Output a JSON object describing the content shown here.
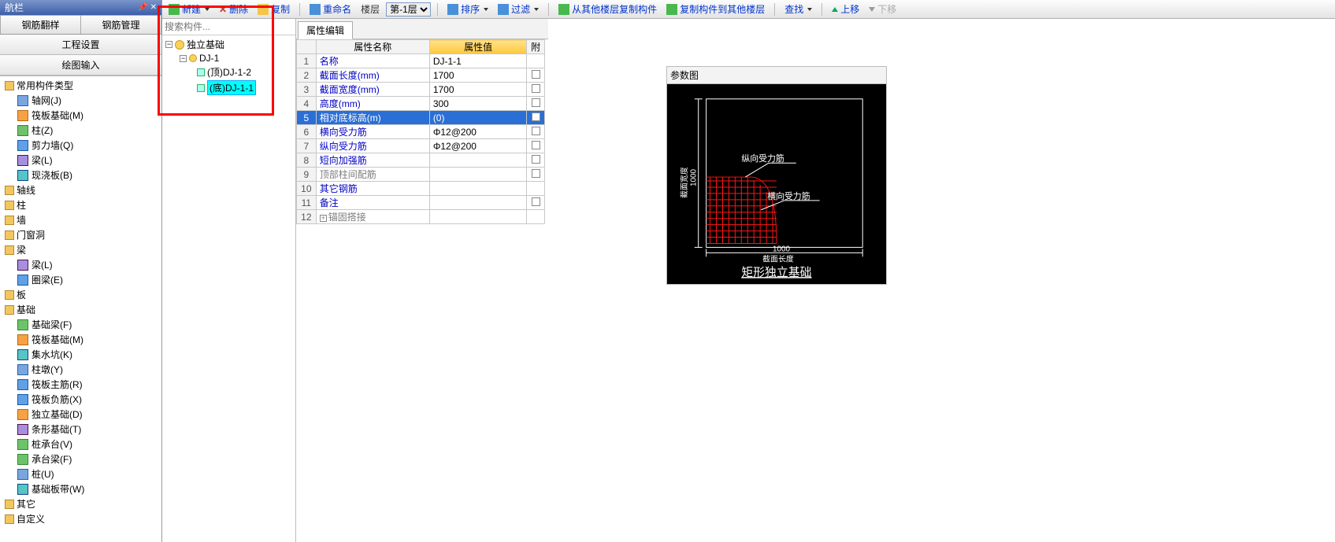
{
  "nav": {
    "title": "航栏",
    "tabs": [
      "钢筋翻样",
      "钢筋管理"
    ],
    "subitems": [
      "工程设置",
      "绘图输入"
    ],
    "tree": [
      {
        "label": "常用构件类型",
        "type": "group"
      },
      {
        "label": "轴网(J)",
        "icon": "g-grid"
      },
      {
        "label": "筏板基础(M)",
        "icon": "g-orange"
      },
      {
        "label": "柱(Z)",
        "icon": "g-green"
      },
      {
        "label": "剪力墙(Q)",
        "icon": "g-blue"
      },
      {
        "label": "梁(L)",
        "icon": "g-purple"
      },
      {
        "label": "现浇板(B)",
        "icon": "g-teal"
      },
      {
        "label": "轴线",
        "type": "group"
      },
      {
        "label": "柱",
        "type": "group"
      },
      {
        "label": "墙",
        "type": "group"
      },
      {
        "label": "门窗洞",
        "type": "group"
      },
      {
        "label": "梁",
        "type": "group"
      },
      {
        "label": "梁(L)",
        "icon": "g-purple"
      },
      {
        "label": "圈梁(E)",
        "icon": "g-blue"
      },
      {
        "label": "板",
        "type": "group"
      },
      {
        "label": "基础",
        "type": "group"
      },
      {
        "label": "基础梁(F)",
        "icon": "g-green"
      },
      {
        "label": "筏板基础(M)",
        "icon": "g-orange"
      },
      {
        "label": "集水坑(K)",
        "icon": "g-teal"
      },
      {
        "label": "柱墩(Y)",
        "icon": "g-grid"
      },
      {
        "label": "筏板主筋(R)",
        "icon": "g-blue"
      },
      {
        "label": "筏板负筋(X)",
        "icon": "g-blue"
      },
      {
        "label": "独立基础(D)",
        "icon": "g-orange"
      },
      {
        "label": "条形基础(T)",
        "icon": "g-purple"
      },
      {
        "label": "桩承台(V)",
        "icon": "g-green"
      },
      {
        "label": "承台梁(F)",
        "icon": "g-green"
      },
      {
        "label": "桩(U)",
        "icon": "g-grid"
      },
      {
        "label": "基础板带(W)",
        "icon": "g-teal"
      },
      {
        "label": "其它",
        "type": "group"
      },
      {
        "label": "自定义",
        "type": "group"
      }
    ]
  },
  "toolbar": {
    "new": "新建",
    "del": "删除",
    "copy": "复制",
    "rename": "重命名",
    "floor_lbl": "楼层",
    "floor_opt": "第-1层",
    "sort": "排序",
    "filter": "过滤",
    "copy_from": "从其他楼层复制构件",
    "copy_to": "复制构件到其他楼层",
    "find": "查找",
    "up": "上移",
    "down": "下移"
  },
  "search": {
    "placeholder": "搜索构件..."
  },
  "mid_tree": {
    "root": "独立基础",
    "lvl1": "DJ-1",
    "lvl2a": "(顶)DJ-1-2",
    "lvl2b": "(底)DJ-1-1"
  },
  "prop": {
    "tab": "属性编辑",
    "headers": {
      "name": "属性名称",
      "value": "属性值",
      "chk": "附"
    },
    "rows": [
      {
        "n": "1",
        "name": "名称",
        "val": "DJ-1-1",
        "chk": false,
        "gray": false
      },
      {
        "n": "2",
        "name": "截面长度(mm)",
        "val": "1700",
        "chk": true,
        "gray": false
      },
      {
        "n": "3",
        "name": "截面宽度(mm)",
        "val": "1700",
        "chk": true,
        "gray": false
      },
      {
        "n": "4",
        "name": "高度(mm)",
        "val": "300",
        "chk": true,
        "gray": false
      },
      {
        "n": "5",
        "name": "相对底标高(m)",
        "val": "(0)",
        "chk": true,
        "gray": false,
        "selected": true
      },
      {
        "n": "6",
        "name": "横向受力筋",
        "val": "Φ12@200",
        "chk": true,
        "gray": false
      },
      {
        "n": "7",
        "name": "纵向受力筋",
        "val": "Φ12@200",
        "chk": true,
        "gray": false
      },
      {
        "n": "8",
        "name": "短向加强筋",
        "val": "",
        "chk": true,
        "gray": false
      },
      {
        "n": "9",
        "name": "顶部柱间配筋",
        "val": "",
        "chk": true,
        "gray": true
      },
      {
        "n": "10",
        "name": "其它钢筋",
        "val": "",
        "chk": false,
        "gray": false
      },
      {
        "n": "11",
        "name": "备注",
        "val": "",
        "chk": true,
        "gray": false
      },
      {
        "n": "12",
        "name": "锚固搭接",
        "val": "",
        "chk": false,
        "gray": true,
        "expand": true
      }
    ]
  },
  "diagram": {
    "title": "参数图",
    "v_lbl": "纵向受力筋",
    "h_lbl": "横向受力筋",
    "dim_h": "1000",
    "dim_h_sub": "截面长度",
    "dim_v": "1000",
    "dim_v_sub": "截面宽度",
    "caption": "矩形独立基础"
  }
}
